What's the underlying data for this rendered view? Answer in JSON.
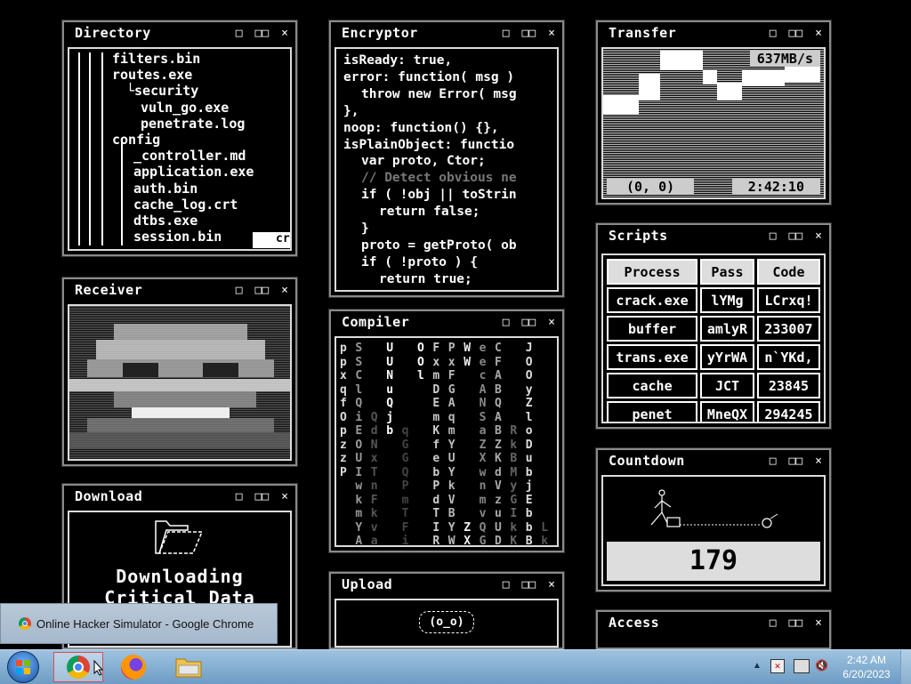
{
  "windows": {
    "directory": {
      "title": "Directory",
      "lines": [
        {
          "indent": 48,
          "text": "filters.bin"
        },
        {
          "indent": 48,
          "text": "routes.exe"
        },
        {
          "indent": 64,
          "text": "└security"
        },
        {
          "indent": 80,
          "text": "vuln_go.exe"
        },
        {
          "indent": 80,
          "text": "penetrate.log"
        },
        {
          "indent": 48,
          "text": "config"
        },
        {
          "indent": 72,
          "text": "_controller.md"
        },
        {
          "indent": 72,
          "text": "application.exe"
        },
        {
          "indent": 72,
          "text": "auth.bin"
        },
        {
          "indent": 72,
          "text": "cache_log.crt"
        },
        {
          "indent": 72,
          "text": "dtbs.exe"
        },
        {
          "indent": 72,
          "text": "session.bin"
        }
      ],
      "cursor_text": "cr"
    },
    "encryptor": {
      "title": "Encryptor",
      "lines": [
        {
          "indent": 1,
          "text": "isReady: true,",
          "dim": false
        },
        {
          "indent": 1,
          "text": "error: function( msg )",
          "dim": false
        },
        {
          "indent": 2,
          "text": "throw new Error( msg",
          "dim": false
        },
        {
          "indent": 1,
          "text": "},",
          "dim": false
        },
        {
          "indent": 1,
          "text": "noop: function() {},",
          "dim": false
        },
        {
          "indent": 1,
          "text": "isPlainObject: functio",
          "dim": false
        },
        {
          "indent": 2,
          "text": "var proto, Ctor;",
          "dim": false
        },
        {
          "indent": 2,
          "text": "// Detect obvious ne",
          "dim": true
        },
        {
          "indent": 2,
          "text": "if ( !obj || toStrin",
          "dim": false
        },
        {
          "indent": 3,
          "text": "return false;",
          "dim": false
        },
        {
          "indent": 2,
          "text": "}",
          "dim": false
        },
        {
          "indent": 2,
          "text": "proto = getProto( ob",
          "dim": false
        },
        {
          "indent": 2,
          "text": "if ( !proto ) {",
          "dim": false
        },
        {
          "indent": 3,
          "text": "return true;",
          "dim": false
        }
      ]
    },
    "transfer": {
      "title": "Transfer",
      "speed": "637MB/s",
      "coords": "(0, 0)",
      "time": "2:42:10"
    },
    "scripts": {
      "title": "Scripts",
      "headers": [
        "Process",
        "Pass",
        "Code"
      ],
      "rows": [
        [
          "crack.exe",
          "lYMg",
          "LCrxq!"
        ],
        [
          "buffer",
          "amlyR",
          "233007"
        ],
        [
          "trans.exe",
          "yYrWA",
          "n`YKd,"
        ],
        [
          "cache",
          "JCT",
          "23845"
        ],
        [
          "penet",
          "MneQX",
          "294245"
        ]
      ]
    },
    "receiver": {
      "title": "Receiver"
    },
    "compiler": {
      "title": "Compiler",
      "columns": [
        {
          "text": "p\np\nx\nq\nf\nO\np\nz\nz\nP",
          "shade": "#ddd"
        },
        {
          "text": "S\nS\nC\nl\nQ\ni\nE\nO\nU\nI\nw\nk\nm\nY\nA",
          "shade": "#999"
        },
        {
          "text": "\n\n\n\n\nQ\nd\nN\nx\nT\nn\nF\nk\nv\na",
          "shade": "#555"
        },
        {
          "text": "U\nU\nN\nu\nQ\nj\nb",
          "shade": "#fff"
        },
        {
          "text": "\n\n\n\n\n\nq\nG\nG\nQ\nP\nm\nT\nF\ni",
          "shade": "#444"
        },
        {
          "text": "O\nO\nl",
          "shade": "#fff"
        },
        {
          "text": "F\nx\nm\nD\nE\nm\nK\nf\ne\nb\nP\nd\nT\nI\nR",
          "shade": "#ccc"
        },
        {
          "text": "P\nx\nF\nG\nA\nq\nm\nY\nU\nY\nk\nV\nB\nY\nW",
          "shade": "#bbb"
        },
        {
          "text": "W\nW\n\n\n\n\n\n\n\n\n\n\n\nZ\nX",
          "shade": "#eee"
        },
        {
          "text": "e\ne\nc\nA\nN\nS\na\nZ\nX\nw\nn\nm\nv\nQ\nG",
          "shade": "#888"
        },
        {
          "text": "C\nF\nA\nB\nQ\nA\nB\nZ\nK\nd\nV\nz\nu\nU\nD",
          "shade": "#aaa"
        },
        {
          "text": "\n\n\n\n\n\nR\nk\nB\nM\ny\nG\nI\nk\nK",
          "shade": "#666"
        },
        {
          "text": "J\nO\nO\ny\nZ\nl\no\nD\nu\nb\nj\nE\nb\nb\nB",
          "shade": "#ddd"
        },
        {
          "text": "\n\n\n\n\n\n\n\n\n\n\n\n\nL\nk",
          "shade": "#555"
        }
      ]
    },
    "download": {
      "title": "Download",
      "message_line1": "Downloading",
      "message_line2": "Critical Data"
    },
    "upload": {
      "title": "Upload",
      "face": "(o_o)"
    },
    "countdown": {
      "title": "Countdown",
      "value": "179"
    },
    "access": {
      "title": "Access"
    }
  },
  "controls": {
    "minimize": "□",
    "maximize": "□□",
    "close": "×"
  },
  "taskbar": {
    "tooltip": "Online Hacker Simulator - Google Chrome",
    "clock_time": "2:42 AM",
    "clock_date": "6/20/2023"
  },
  "colors": {
    "taskbar": "#8fb5d7",
    "window_border": "#8a8a8a",
    "inner_border": "#dcdcdc",
    "countdown_bg": "#dddddd"
  }
}
